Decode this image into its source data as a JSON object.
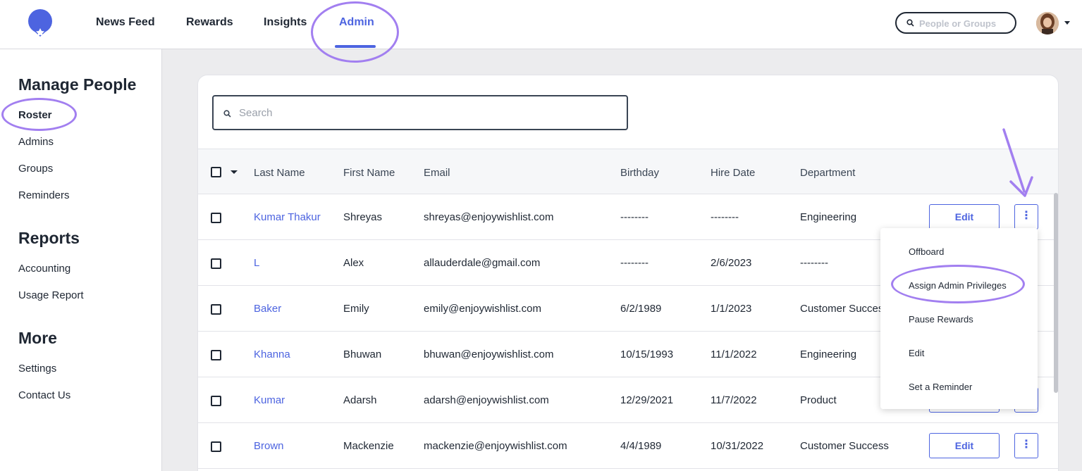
{
  "nav": {
    "items": [
      {
        "label": "News Feed"
      },
      {
        "label": "Rewards"
      },
      {
        "label": "Insights"
      },
      {
        "label": "Admin"
      }
    ],
    "search_placeholder": "People or Groups"
  },
  "sidebar": {
    "sections": [
      {
        "heading": "Manage People",
        "links": [
          "Roster",
          "Admins",
          "Groups",
          "Reminders"
        ]
      },
      {
        "heading": "Reports",
        "links": [
          "Accounting",
          "Usage Report"
        ]
      },
      {
        "heading": "More",
        "links": [
          "Settings",
          "Contact Us"
        ]
      }
    ]
  },
  "table": {
    "search_placeholder": "Search",
    "columns": [
      "Last Name",
      "First Name",
      "Email",
      "Birthday",
      "Hire Date",
      "Department"
    ],
    "edit_label": "Edit",
    "kebab_label": "⋮",
    "rows": [
      {
        "last": "Kumar Thakur",
        "first": "Shreyas",
        "email": "shreyas@enjoywishlist.com",
        "birthday": "--------",
        "hire": "--------",
        "dept": "Engineering"
      },
      {
        "last": "L",
        "first": "Alex",
        "email": "allauderdale@gmail.com",
        "birthday": "--------",
        "hire": "2/6/2023",
        "dept": "--------"
      },
      {
        "last": "Baker",
        "first": "Emily",
        "email": "emily@enjoywishlist.com",
        "birthday": "6/2/1989",
        "hire": "1/1/2023",
        "dept": "Customer Success"
      },
      {
        "last": "Khanna",
        "first": "Bhuwan",
        "email": "bhuwan@enjoywishlist.com",
        "birthday": "10/15/1993",
        "hire": "11/1/2022",
        "dept": "Engineering"
      },
      {
        "last": "Kumar",
        "first": "Adarsh",
        "email": "adarsh@enjoywishlist.com",
        "birthday": "12/29/2021",
        "hire": "11/7/2022",
        "dept": "Product"
      },
      {
        "last": "Brown",
        "first": "Mackenzie",
        "email": "mackenzie@enjoywishlist.com",
        "birthday": "4/4/1989",
        "hire": "10/31/2022",
        "dept": "Customer Success"
      }
    ]
  },
  "menu": {
    "items": [
      "Offboard",
      "Assign Admin Privileges",
      "Pause Rewards",
      "Edit",
      "Set a Reminder"
    ]
  },
  "colors": {
    "accent": "#4d64e0",
    "highlight": "#a27ff0"
  }
}
